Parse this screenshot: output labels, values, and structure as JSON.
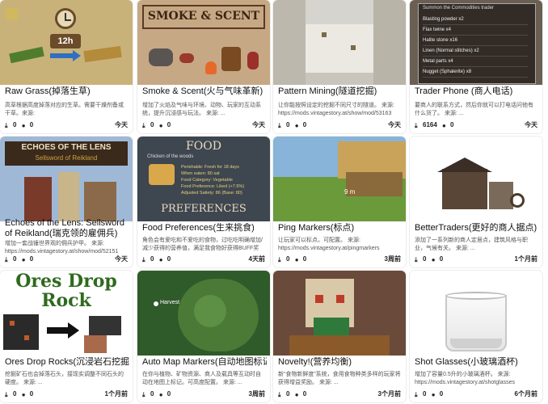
{
  "cards": [
    {
      "title": "Raw Grass(掉落生草)",
      "desc": "高草根据高度掉落对应的生草。需要干燥剂备或干草。来源: https://mods.vintagestory.at/rawgrassmod",
      "downloads": "0",
      "comments": "0",
      "age": "今天",
      "thumb_text": "12h"
    },
    {
      "title": "Smoke & Scent(火与气味革新)",
      "desc": "增加了火焰及气味与环境、动物、玩家的互动系统，提升沉浸感与玩法。 来源: ...",
      "downloads": "0",
      "comments": "0",
      "age": "今天",
      "thumb_text": "SMOKE & SCENT"
    },
    {
      "title": "Pattern Mining(隧道挖掘)",
      "desc": "让你能按照设定的挖掘不同尺寸的隧道。 来源: https://mods.vintagestory.at/show/mod/53163",
      "downloads": "0",
      "comments": "0",
      "age": "今天",
      "thumb_text": ""
    },
    {
      "title": "Trader Phone (商人电话)",
      "desc": "要商人的联系方式，然后你就可以打电话问他有什么货了。 来源: ...",
      "downloads": "6164",
      "comments": "0",
      "age": "今天",
      "thumb_header": "Summon the Commodities trader",
      "thumb_items": [
        "Blasting powder x2",
        "Flax twine x4",
        "Halite stone x16",
        "Linen (Normal stitches) x2",
        "Metal parts x4",
        "Nugget (Sphalerite) x8"
      ]
    },
    {
      "title": "Echoes of the Lens: Sellsword of Reikland(瑞克领的雇佣兵)",
      "desc": "增加一套战锤世界观的佣兵护甲。 来源: https://mods.vintagestory.at/show/mod/52151",
      "downloads": "0",
      "comments": "0",
      "age": "今天",
      "thumb_title": "ECHOES OF THE LENS",
      "thumb_sub": "Sellsword of Reikland"
    },
    {
      "title": "Food Preferences(生来挑食)",
      "desc": "角色会有爱吃和不爱吃的食物，过吃吃明确增加/减少获得的营养值，满足我食物好获得BUFF奖励。 来源: ...",
      "downloads": "0",
      "comments": "0",
      "age": "4天前",
      "thumb_top": "FOOD",
      "thumb_bottom": "PREFERENCES",
      "thumb_item": "Chicken of the woods",
      "thumb_lines": [
        "Perishable: Fresh for 18 days",
        "When eaten: 80 sat",
        "Food Category: Vegetable",
        "Food Preference: Liked (+7.5%)",
        "Adjusted Satiety: 86 (Base: 80)"
      ]
    },
    {
      "title": "Ping Markers(标点)",
      "desc": "让玩家可以标点。可配置。 来源: https://mods.vintagestory.at/pingmarkers",
      "downloads": "0",
      "comments": "0",
      "age": "3周前",
      "thumb_text": "9 m"
    },
    {
      "title": "BetterTraders(更好的商人据点)",
      "desc": "添加了一系列新的商人定居点，建筑风格与职业，气候有关。 来源: ...",
      "downloads": "0",
      "comments": "0",
      "age": "1个月前"
    },
    {
      "title": "Ores Drop Rocks(沉浸岩石挖掘)",
      "desc": "挖掘矿石也会掉落石头，接现实调整不同石头的硬度。 来源: ...",
      "downloads": "0",
      "comments": "0",
      "age": "1个月前",
      "thumb_l1": "Ores Drop",
      "thumb_l2": "Rock"
    },
    {
      "title": "Auto Map Markers(自动地图标记)",
      "desc": "在你与植物、矿物资源、商人及载具等互动时自动在地图上标记。可高度配置。 来源: ...",
      "downloads": "0",
      "comments": "0",
      "age": "3周前",
      "thumb_text": "Harvest"
    },
    {
      "title": "Novelty!(营养均衡)",
      "desc": "新“食物新鲜度”系统，食用食物种类多样的玩家将获得增益奖励。 来源: ...",
      "downloads": "0",
      "comments": "0",
      "age": "3个月前"
    },
    {
      "title": "Shot Glasses(小玻璃酒杯)",
      "desc": "增加了容量0.5升的小玻璃酒杯。 来源: https://mods.vintagestory.at/shotglasses",
      "downloads": "0",
      "comments": "0",
      "age": "6个月前"
    }
  ]
}
